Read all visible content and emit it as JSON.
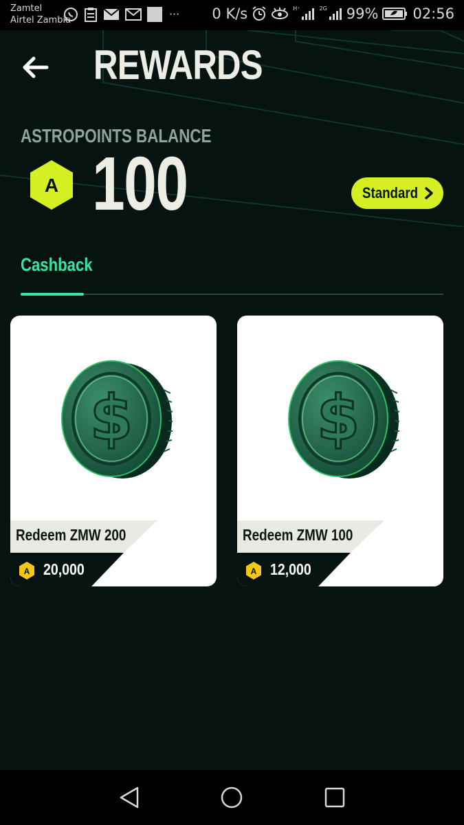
{
  "status_bar": {
    "carrier_1": "Zamtel",
    "carrier_2": "Airtel Zambia",
    "more": "···",
    "net_speed": "0 K/s",
    "signal_tag_1": "H⁺",
    "signal_tag_2": "2G",
    "battery": "99%",
    "time": "02:56"
  },
  "header": {
    "title": "REWARDS",
    "back_icon": "arrow-left-icon"
  },
  "balance": {
    "label": "ASTROPOINTS BALANCE",
    "icon_letter": "A",
    "value": "100",
    "tier_label": "Standard"
  },
  "tabs": [
    {
      "label": "Cashback",
      "active": true
    }
  ],
  "rewards": [
    {
      "title": "Redeem ZMW 200",
      "cost": "20,000",
      "cost_icon_letter": "A",
      "image": "dollar-coin-icon"
    },
    {
      "title": "Redeem ZMW 100",
      "cost": "12,000",
      "cost_icon_letter": "A",
      "image": "dollar-coin-icon"
    }
  ],
  "colors": {
    "background": "#061311",
    "accent_lime": "#d4ef22",
    "accent_green": "#35e6a4",
    "points_yellow": "#f5c518",
    "coin_green": "#1f6a4e"
  },
  "nav_bar": {
    "back": "triangle-back-icon",
    "home": "circle-home-icon",
    "recents": "square-recents-icon"
  }
}
